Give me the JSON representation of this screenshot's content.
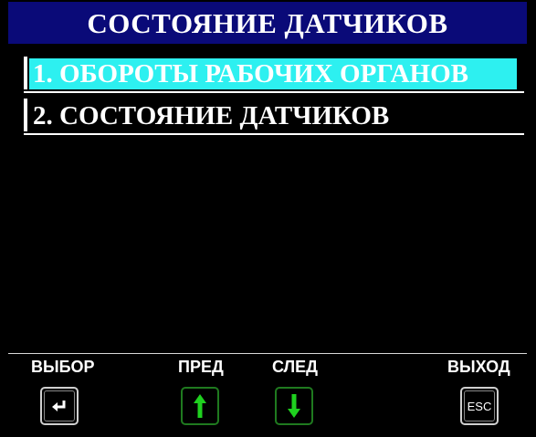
{
  "header": {
    "title": "СОСТОЯНИЕ ДАТЧИКОВ"
  },
  "menu": {
    "items": [
      {
        "label": "1. ОБОРОТЫ РАБОЧИХ ОРГАНОВ",
        "selected": true
      },
      {
        "label": "2. СОСТОЯНИЕ ДАТЧИКОВ",
        "selected": false
      }
    ]
  },
  "softkeys": {
    "select_label": "ВЫБОР",
    "prev_label": "ПРЕД",
    "next_label": "СЛЕД",
    "exit_label": "ВЫХОД",
    "esc_key_text": "ESC"
  },
  "colors": {
    "title_bg": "#0a0a78",
    "highlight": "#2df0f0",
    "arrow_green": "#1fd11f",
    "key_border_green": "#1f7a1f"
  },
  "icons": {
    "select": "enter-icon",
    "prev": "arrow-up-icon",
    "next": "arrow-down-icon",
    "exit": "esc-icon"
  }
}
